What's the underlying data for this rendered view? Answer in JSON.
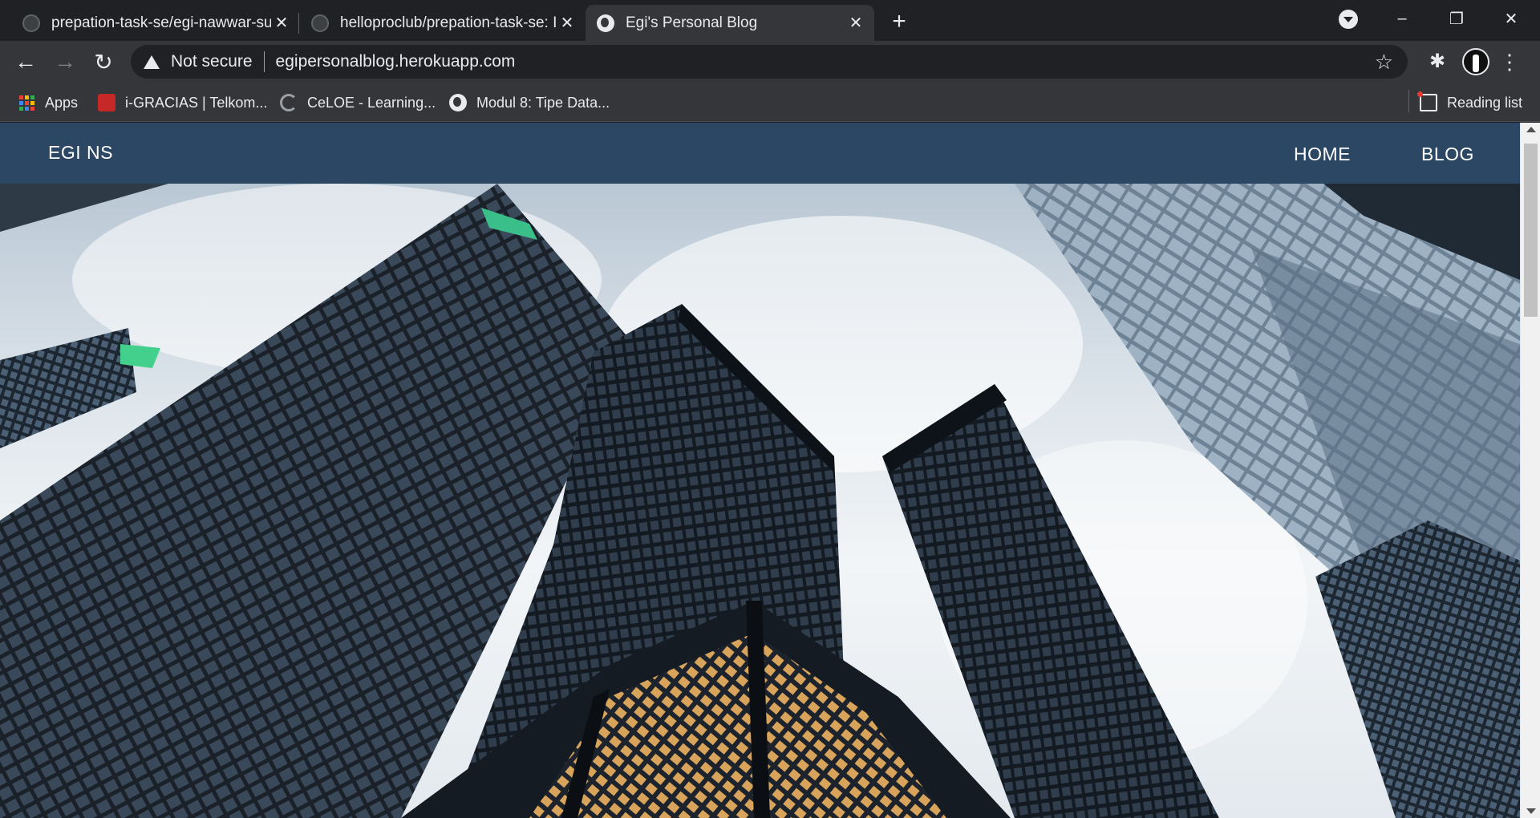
{
  "browser": {
    "tabs": [
      {
        "title": "prepation-task-se/egi-nawwar-su",
        "icon": "github-icon",
        "active": false
      },
      {
        "title": "helloproclub/prepation-task-se: I",
        "icon": "github-icon",
        "active": false
      },
      {
        "title": "Egi's Personal Blog",
        "icon": "globe-icon",
        "active": true
      }
    ],
    "new_tab_label": "+",
    "window": {
      "minimize": "–",
      "restore": "❐",
      "close": "✕"
    },
    "toolbar": {
      "back": "←",
      "forward": "→",
      "reload": "↻",
      "security_label": "Not secure",
      "url": "egipersonalblog.herokuapp.com",
      "star": "☆",
      "extensions": "✱",
      "menu": "⋮"
    },
    "bookmarks": [
      {
        "label": "Apps",
        "icon": "apps-grid-icon"
      },
      {
        "label": "i-GRACIAS | Telkom...",
        "icon": "igracias-icon"
      },
      {
        "label": "CeLOE - Learning...",
        "icon": "celoe-icon"
      },
      {
        "label": "Modul 8: Tipe Data...",
        "icon": "globe-icon"
      }
    ],
    "reading_list": "Reading list"
  },
  "site": {
    "brand": "EGI NS",
    "nav": [
      {
        "label": "HOME"
      },
      {
        "label": "BLOG"
      }
    ],
    "hero_image": "skyscrapers-looking-up",
    "colors": {
      "navbar": "#2c4763",
      "text": "#ffffff"
    }
  }
}
